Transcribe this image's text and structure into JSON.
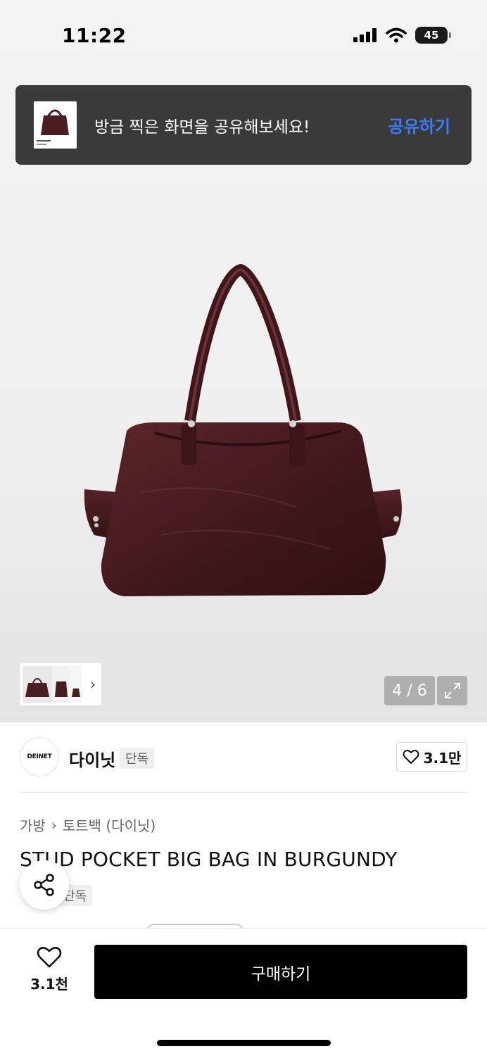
{
  "status_bar": {
    "time": "11:22",
    "battery": "45"
  },
  "toast": {
    "message": "방금 찍은 화면을 공유해보세요!",
    "action": "공유하기"
  },
  "gallery": {
    "counter": "4 / 6",
    "thumb_chevron": "›"
  },
  "brand": {
    "logo_text": "DEINET",
    "name": "다이닛",
    "tag": "단독",
    "likes": "3.1만"
  },
  "breadcrumb": {
    "category": "가방",
    "separator": "›",
    "subcategory": "토트백 (다이닛)"
  },
  "product": {
    "title": "STUD POCKET BIG BAG IN BURGUNDY",
    "tag": "단독"
  },
  "bottom_bar": {
    "wish_count": "3.1천",
    "buy_label": "구매하기"
  },
  "colors": {
    "accent": "#3b7cff",
    "bag": "#4a1d21",
    "buy_bg": "#000000"
  }
}
